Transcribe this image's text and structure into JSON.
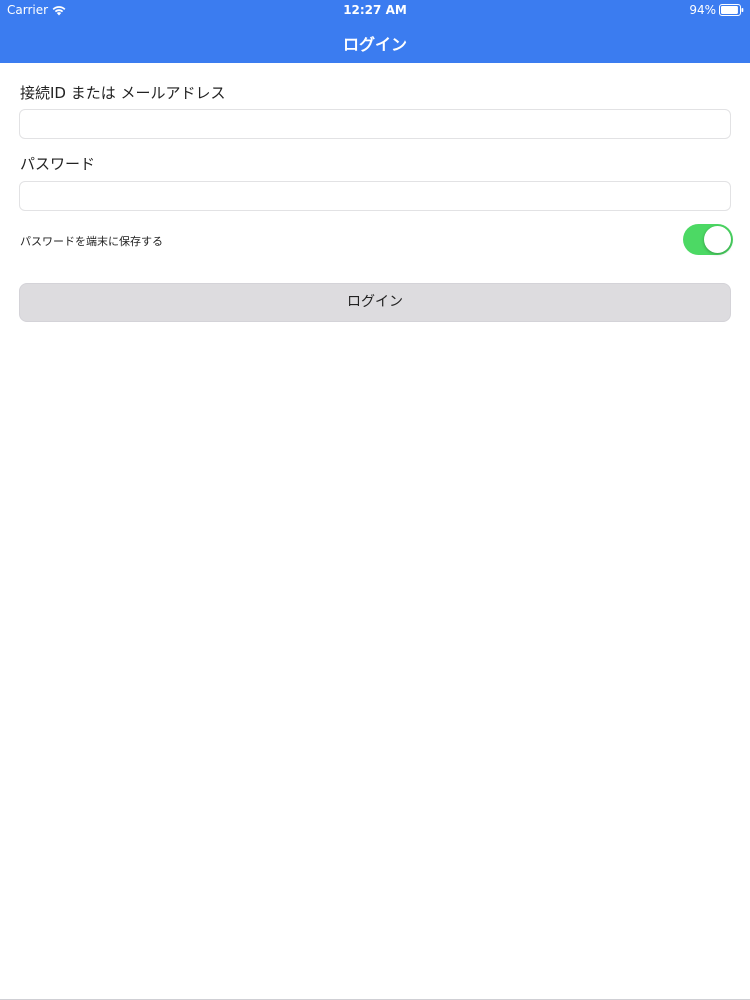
{
  "status_bar": {
    "carrier": "Carrier",
    "time": "12:27 AM",
    "battery": "94%",
    "battery_level": 0.94,
    "wifi_icon": "wifi-icon",
    "battery_icon": "battery-icon"
  },
  "nav": {
    "title": "ログイン",
    "background_color": "#3b7cf0"
  },
  "form": {
    "id_label": "接続ID または メールアドレス",
    "id_value": "",
    "password_label": "パスワード",
    "password_value": "",
    "remember_label": "パスワードを端末に保存する",
    "remember_enabled": true,
    "toggle_color": "#4cd964",
    "login_button": "ログイン"
  }
}
